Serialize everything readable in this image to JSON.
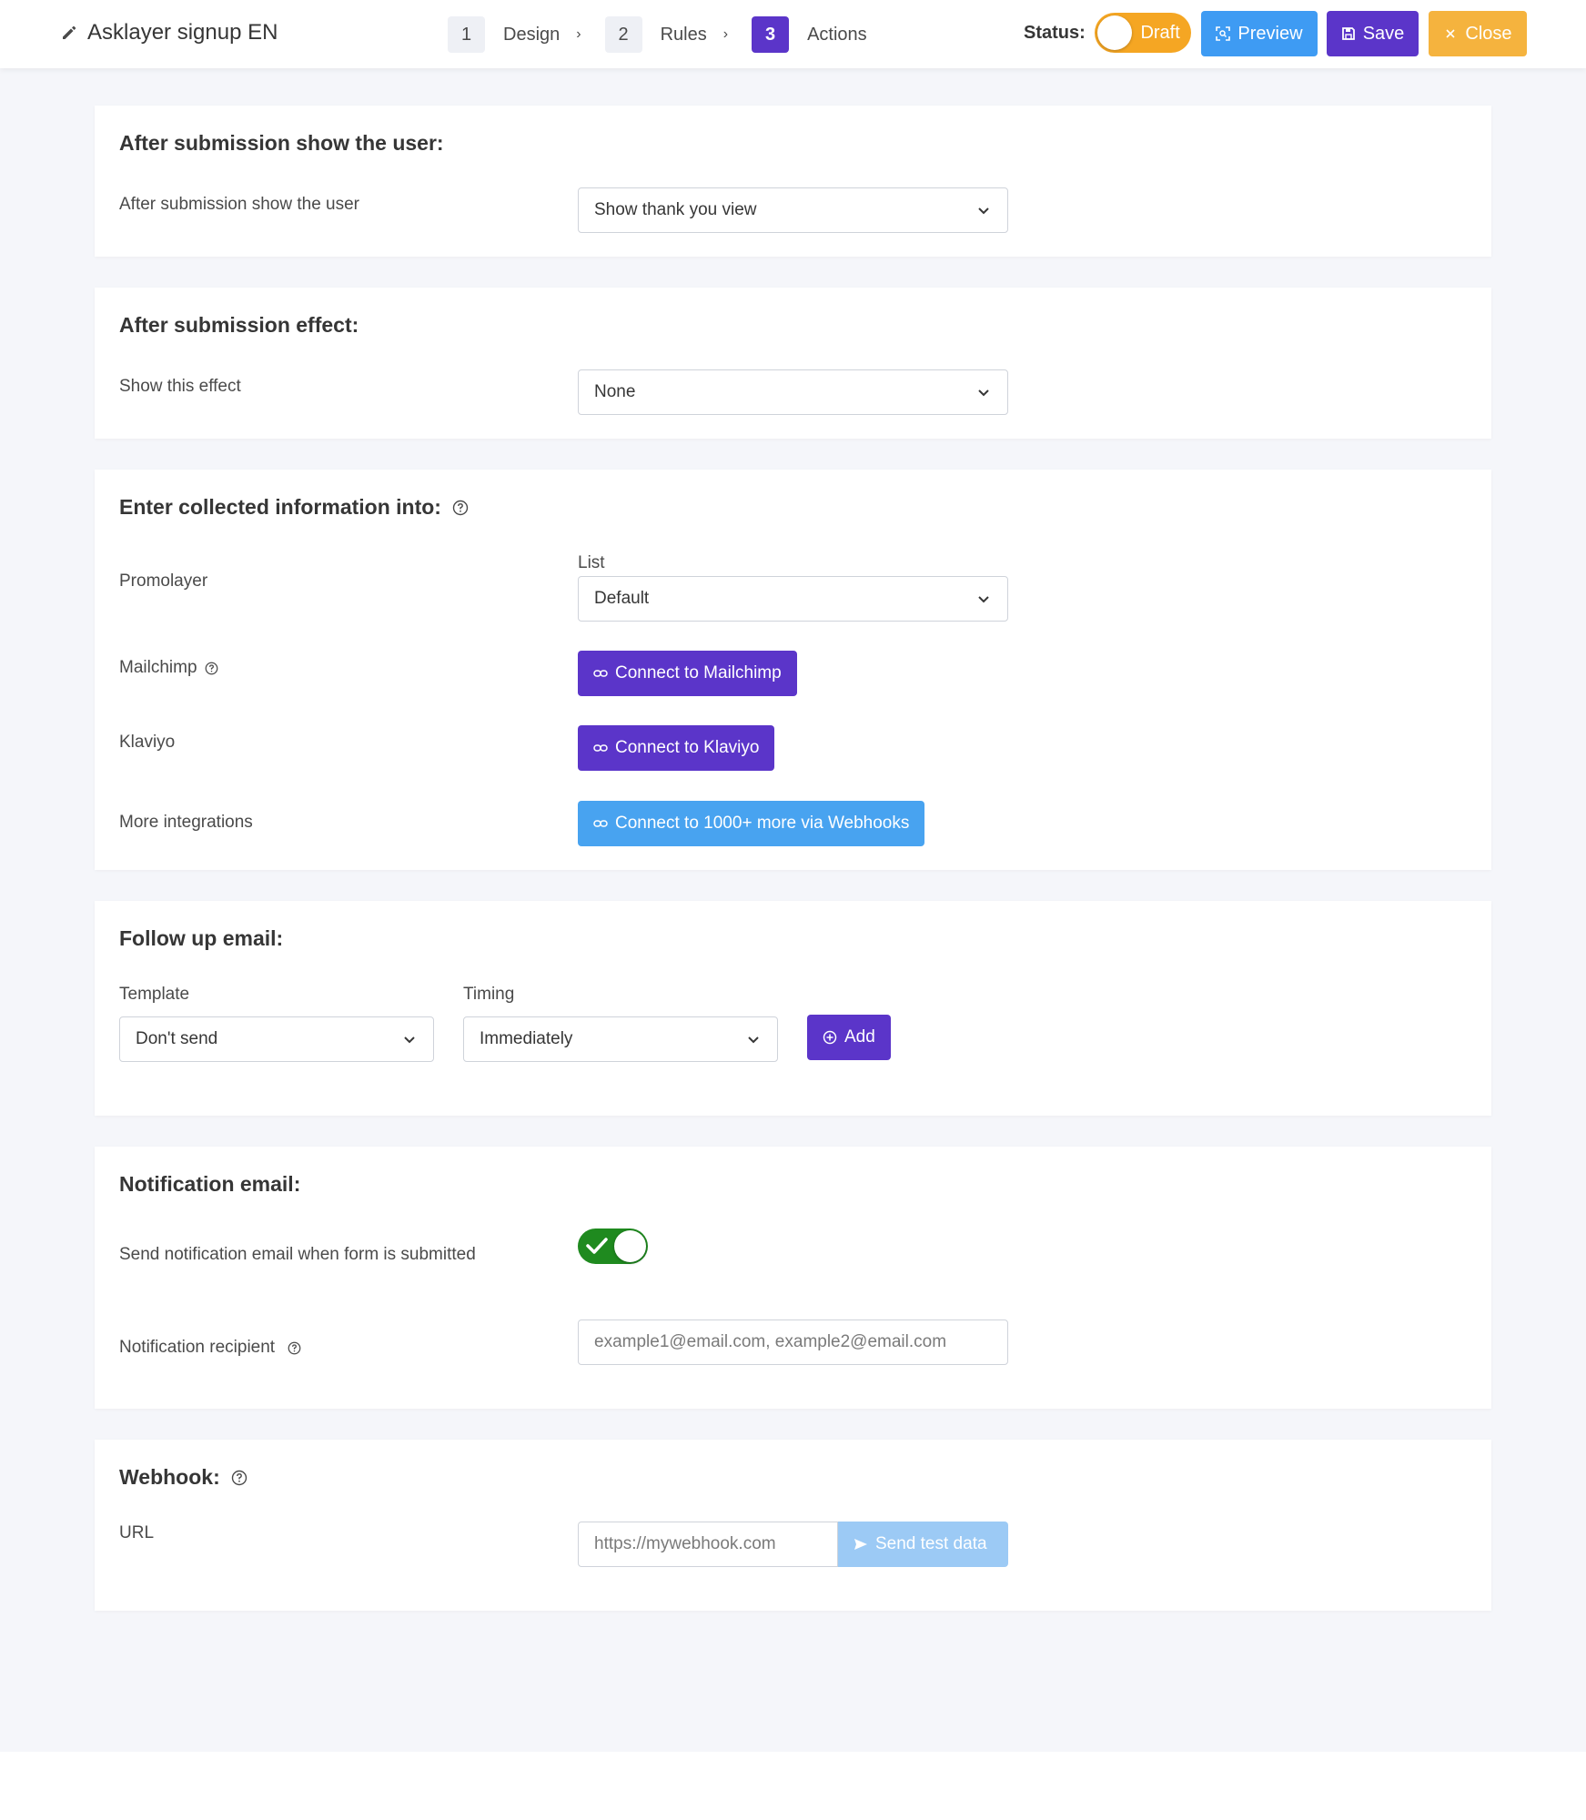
{
  "header": {
    "title": "Asklayer signup EN",
    "steps": [
      {
        "num": "1",
        "label": "Design"
      },
      {
        "num": "2",
        "label": "Rules"
      },
      {
        "num": "3",
        "label": "Actions"
      }
    ],
    "status_label": "Status:",
    "status_value": "Draft",
    "preview_label": "Preview",
    "save_label": "Save",
    "close_label": "Close"
  },
  "after_submission": {
    "title": "After submission show the user:",
    "label": "After submission show the user",
    "selected": "Show thank you view"
  },
  "effect": {
    "title": "After submission effect:",
    "label": "Show this effect",
    "selected": "None"
  },
  "collected": {
    "title": "Enter collected information into:",
    "promolayer_label": "Promolayer",
    "list_label": "List",
    "list_selected": "Default",
    "mailchimp_label": "Mailchimp",
    "mailchimp_button": "Connect to Mailchimp",
    "klaviyo_label": "Klaviyo",
    "klaviyo_button": "Connect to Klaviyo",
    "more_label": "More integrations",
    "webhooks_button": "Connect to 1000+ more via Webhooks"
  },
  "followup": {
    "title": "Follow up email:",
    "template_label": "Template",
    "template_selected": "Don't send",
    "timing_label": "Timing",
    "timing_selected": "Immediately",
    "add_button": "Add"
  },
  "notification": {
    "title": "Notification email:",
    "send_label": "Send notification email when form is submitted",
    "send_enabled": true,
    "recipient_label": "Notification recipient",
    "recipient_placeholder": "example1@email.com, example2@email.com"
  },
  "webhook": {
    "title": "Webhook:",
    "url_label": "URL",
    "url_placeholder": "https://mywebhook.com",
    "send_test_button": "Send test data"
  },
  "colors": {
    "accent_purple": "#5b35c9",
    "accent_blue": "#3e9bf3",
    "accent_orange": "#f5b33e",
    "toggle_green": "#1f8a1f"
  }
}
